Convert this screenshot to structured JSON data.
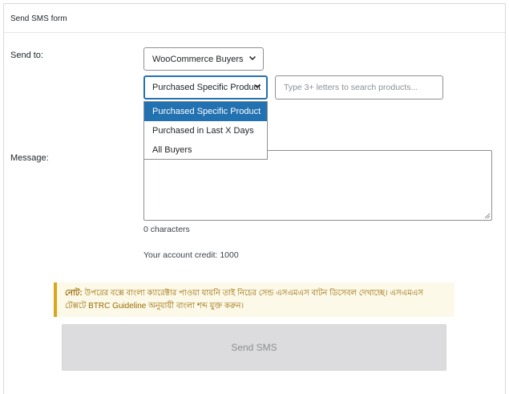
{
  "panel": {
    "title": "Send SMS form"
  },
  "form": {
    "send_to_label": "Send to:",
    "recipient_type": {
      "value": "WooCommerce Buyers",
      "icon": "chevron-down-icon"
    },
    "buyer_filter": {
      "value": "Purchased Specific Product",
      "icon": "chevron-down-icon",
      "options": [
        "Purchased Specific Product",
        "Purchased in Last X Days",
        "All Buyers"
      ],
      "selected_index": 0
    },
    "product_search": {
      "placeholder": "Type 3+ letters to search products..."
    },
    "message_label": "Message:",
    "message": {
      "value": ""
    },
    "char_count": "0 characters",
    "account_credit": "Your account credit: 1000"
  },
  "notice": {
    "prefix": "নোট:",
    "text": " উপরের বক্সে বাংলা ক্যারেক্টার পাওয়া যায়নি তাই নিচের সেন্ড এসএমএস বাটন ডিসেবল দেখাচ্ছে। এসএমএস টেক্সটে BTRC Guideline অনুযায়ী বাংলা শব্দ যুক্ত করুন।"
  },
  "send_button": {
    "label": "Send SMS",
    "disabled": true
  },
  "colors": {
    "accent": "#2271b1",
    "notice_border": "#dba617",
    "notice_bg": "#fcf9e8",
    "button_disabled_bg": "#dcdcde"
  }
}
